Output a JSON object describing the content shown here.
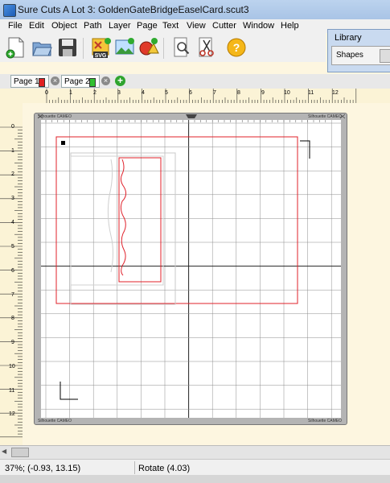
{
  "window": {
    "title": "Sure Cuts A Lot 3: GoldenGateBridgeEaselCard.scut3"
  },
  "menu": [
    "File",
    "Edit",
    "Object",
    "Path",
    "Layer",
    "Page",
    "Text",
    "View",
    "Cutter",
    "Window",
    "Help"
  ],
  "toolbar": [
    {
      "name": "new-document-icon"
    },
    {
      "name": "open-folder-icon"
    },
    {
      "name": "save-disk-icon"
    },
    {
      "name": "import-svg-icon",
      "label": "SVG"
    },
    {
      "name": "import-image-icon"
    },
    {
      "name": "shapes-icon"
    },
    {
      "name": "preview-magnifier-icon"
    },
    {
      "name": "cut-scissors-icon"
    },
    {
      "name": "help-icon",
      "label": "?"
    }
  ],
  "library": {
    "title": "Library",
    "dropdown_value": "Shapes"
  },
  "tabs": [
    {
      "label": "Page 1",
      "color": "#e02020"
    },
    {
      "label": "Page 2",
      "color": "#30c030"
    }
  ],
  "add_page": "+",
  "ruler": {
    "h_labels": [
      "0",
      "1",
      "2",
      "3",
      "4",
      "5",
      "6",
      "7",
      "8",
      "9",
      "10",
      "11",
      "12"
    ],
    "v_labels": [
      "0",
      "1",
      "2",
      "3",
      "4",
      "5",
      "6",
      "7",
      "8",
      "9",
      "10",
      "11",
      "12"
    ]
  },
  "mat": {
    "brand_text": "Silhouette CAMEO"
  },
  "status": {
    "zoom_coords": "37%; (-0.93, 13.15)",
    "action": "Rotate (4.03)"
  },
  "colors": {
    "accent_red": "#e0202a",
    "grid_line": "#8c8c8c",
    "mat_border": "#b4b4b4",
    "canvas_bg": "#fdf6e0"
  }
}
